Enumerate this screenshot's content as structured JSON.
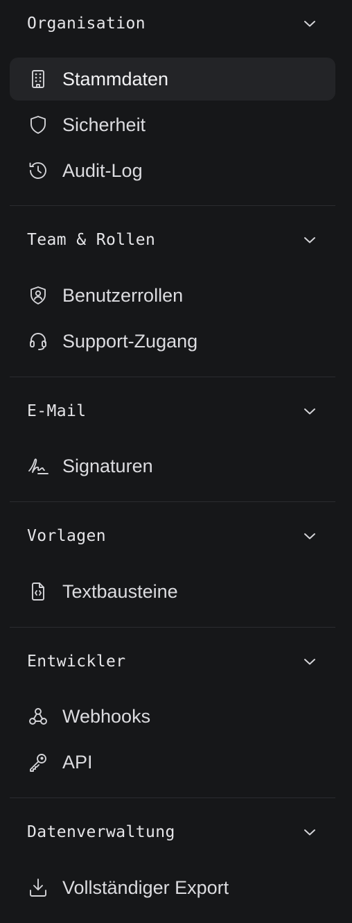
{
  "sections": [
    {
      "title": "Organisation",
      "items": [
        {
          "label": "Stammdaten",
          "icon": "building-icon",
          "active": true
        },
        {
          "label": "Sicherheit",
          "icon": "shield-icon",
          "active": false
        },
        {
          "label": "Audit-Log",
          "icon": "history-icon",
          "active": false
        }
      ]
    },
    {
      "title": "Team & Rollen",
      "items": [
        {
          "label": "Benutzerrollen",
          "icon": "shield-user-icon",
          "active": false
        },
        {
          "label": "Support-Zugang",
          "icon": "headset-icon",
          "active": false
        }
      ]
    },
    {
      "title": "E-Mail",
      "items": [
        {
          "label": "Signaturen",
          "icon": "signature-icon",
          "active": false
        }
      ]
    },
    {
      "title": "Vorlagen",
      "items": [
        {
          "label": "Textbausteine",
          "icon": "file-code-icon",
          "active": false
        }
      ]
    },
    {
      "title": "Entwickler",
      "items": [
        {
          "label": "Webhooks",
          "icon": "webhook-icon",
          "active": false
        },
        {
          "label": "API",
          "icon": "key-icon",
          "active": false
        }
      ]
    },
    {
      "title": "Datenverwaltung",
      "items": [
        {
          "label": "Vollständiger Export",
          "icon": "download-icon",
          "active": false
        }
      ]
    }
  ],
  "colors": {
    "background": "#161719",
    "active_item": "#232427",
    "text": "#dcdce0",
    "divider": "#2b2c30"
  }
}
